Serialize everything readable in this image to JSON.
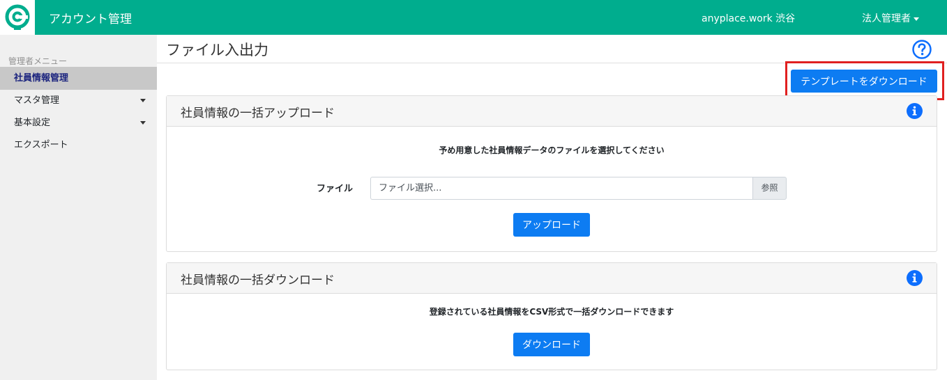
{
  "header": {
    "app_title": "アカウント管理",
    "workspace": "anyplace.work 渋谷",
    "admin_label": "法人管理者",
    "brand_color": "#00ad8e"
  },
  "sidebar": {
    "heading": "管理者メニュー",
    "items": [
      {
        "label": "社員情報管理",
        "active": true,
        "has_caret": false
      },
      {
        "label": "マスタ管理",
        "active": false,
        "has_caret": true
      },
      {
        "label": "基本設定",
        "active": false,
        "has_caret": true
      },
      {
        "label": "エクスポート",
        "active": false,
        "has_caret": false
      }
    ]
  },
  "main": {
    "page_title": "ファイル入出力",
    "template_button": "テンプレートをダウンロード",
    "upload_card": {
      "title": "社員情報の一括アップロード",
      "description": "予め用意した社員情報データのファイルを選択してください",
      "file_label": "ファイル",
      "file_placeholder": "ファイル選択...",
      "browse_label": "参照",
      "upload_button": "アップロード"
    },
    "download_card": {
      "title": "社員情報の一括ダウンロード",
      "description": "登録されている社員情報をCSV形式で一括ダウンロードできます",
      "download_button": "ダウンロード"
    }
  },
  "colors": {
    "primary_button": "#0d7cf2",
    "highlight": "#e02020"
  }
}
